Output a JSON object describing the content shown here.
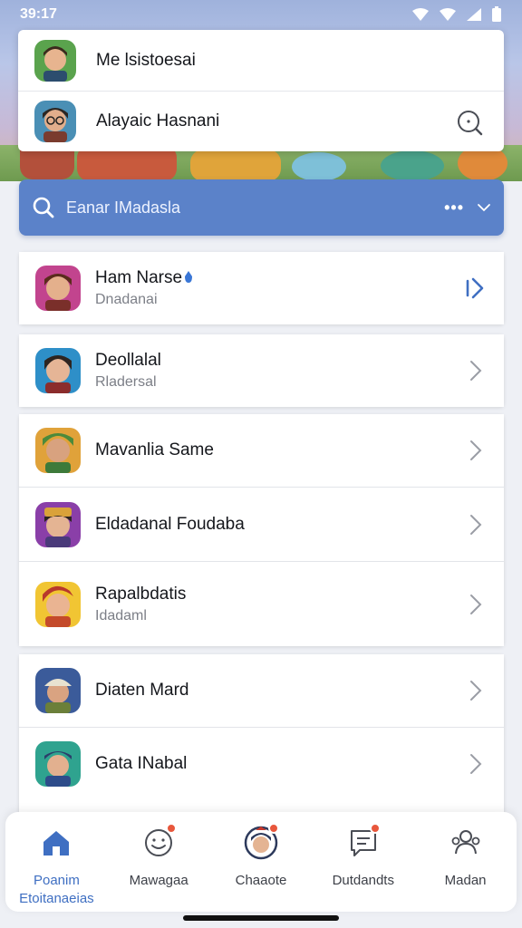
{
  "status_bar": {
    "time": "39:17"
  },
  "accounts": [
    {
      "name": "Me lsistoesai",
      "avatar": "avatar-green-hair"
    },
    {
      "name": "Alayaic Hasnani",
      "avatar": "avatar-glasses"
    }
  ],
  "account_search_icon": "search-icon",
  "search": {
    "placeholder": "Eanar IMadasla",
    "more": "•••"
  },
  "list": [
    {
      "title": "Ham Narse",
      "subtitle": "Dnadanai",
      "verified": true,
      "active": true
    },
    {
      "title": "Deollalal",
      "subtitle": "Rladersal"
    },
    {
      "title": "Mavanlia Same",
      "subtitle": ""
    },
    {
      "title": "Eldadanal Foudaba",
      "subtitle": ""
    },
    {
      "title": "Rapalbdatis",
      "subtitle": "Idadaml"
    },
    {
      "title": "Diaten Mard",
      "subtitle": ""
    },
    {
      "title": "Gata INabal",
      "subtitle": ""
    }
  ],
  "nav": [
    {
      "label": "Poanim",
      "label2": "Etoitanaeias",
      "icon": "home-icon",
      "active": true
    },
    {
      "label": "Mawagaa",
      "icon": "smiley-icon",
      "badge": true
    },
    {
      "label": "Chaaote",
      "icon": "character-icon",
      "badge": true
    },
    {
      "label": "Dutdandts",
      "icon": "message-icon",
      "badge": true
    },
    {
      "label": "Madan",
      "icon": "people-icon"
    }
  ],
  "colors": {
    "accent": "#5b82c9",
    "nav_active": "#3f6fc2",
    "badge": "#e8573c"
  }
}
